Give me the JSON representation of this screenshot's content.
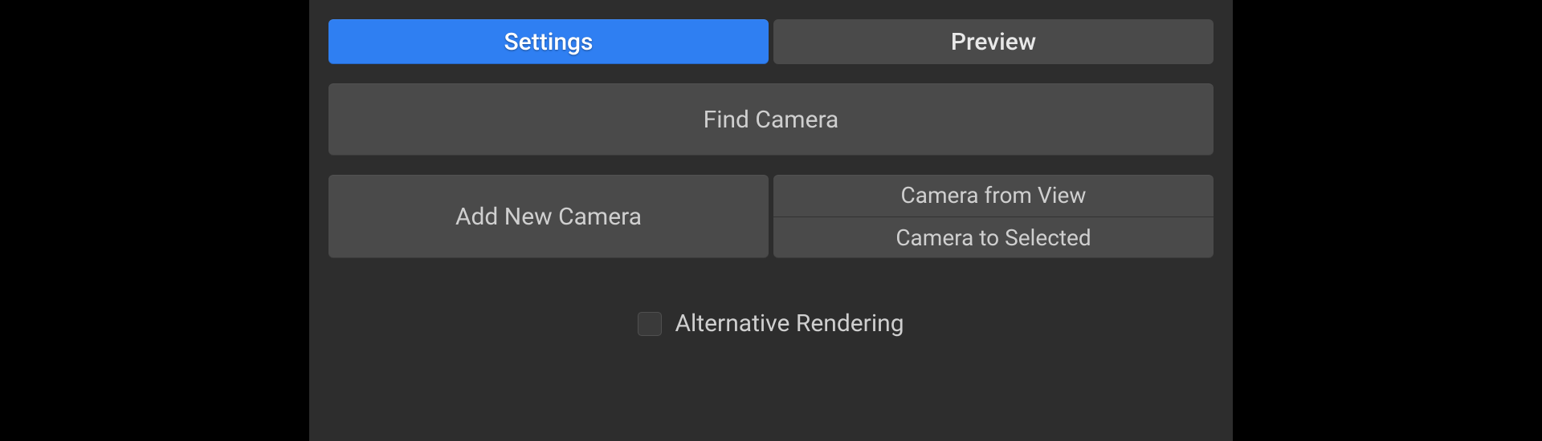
{
  "tabs": {
    "settings": "Settings",
    "preview": "Preview",
    "active": "settings"
  },
  "buttons": {
    "find_camera": "Find Camera",
    "add_new_camera": "Add New Camera",
    "camera_from_view": "Camera from View",
    "camera_to_selected": "Camera to Selected"
  },
  "options": {
    "alternative_rendering": {
      "label": "Alternative Rendering",
      "checked": false
    }
  },
  "colors": {
    "accent": "#2f7ff2",
    "panel_bg": "#2d2d2d",
    "button_bg": "#4a4a4a"
  }
}
